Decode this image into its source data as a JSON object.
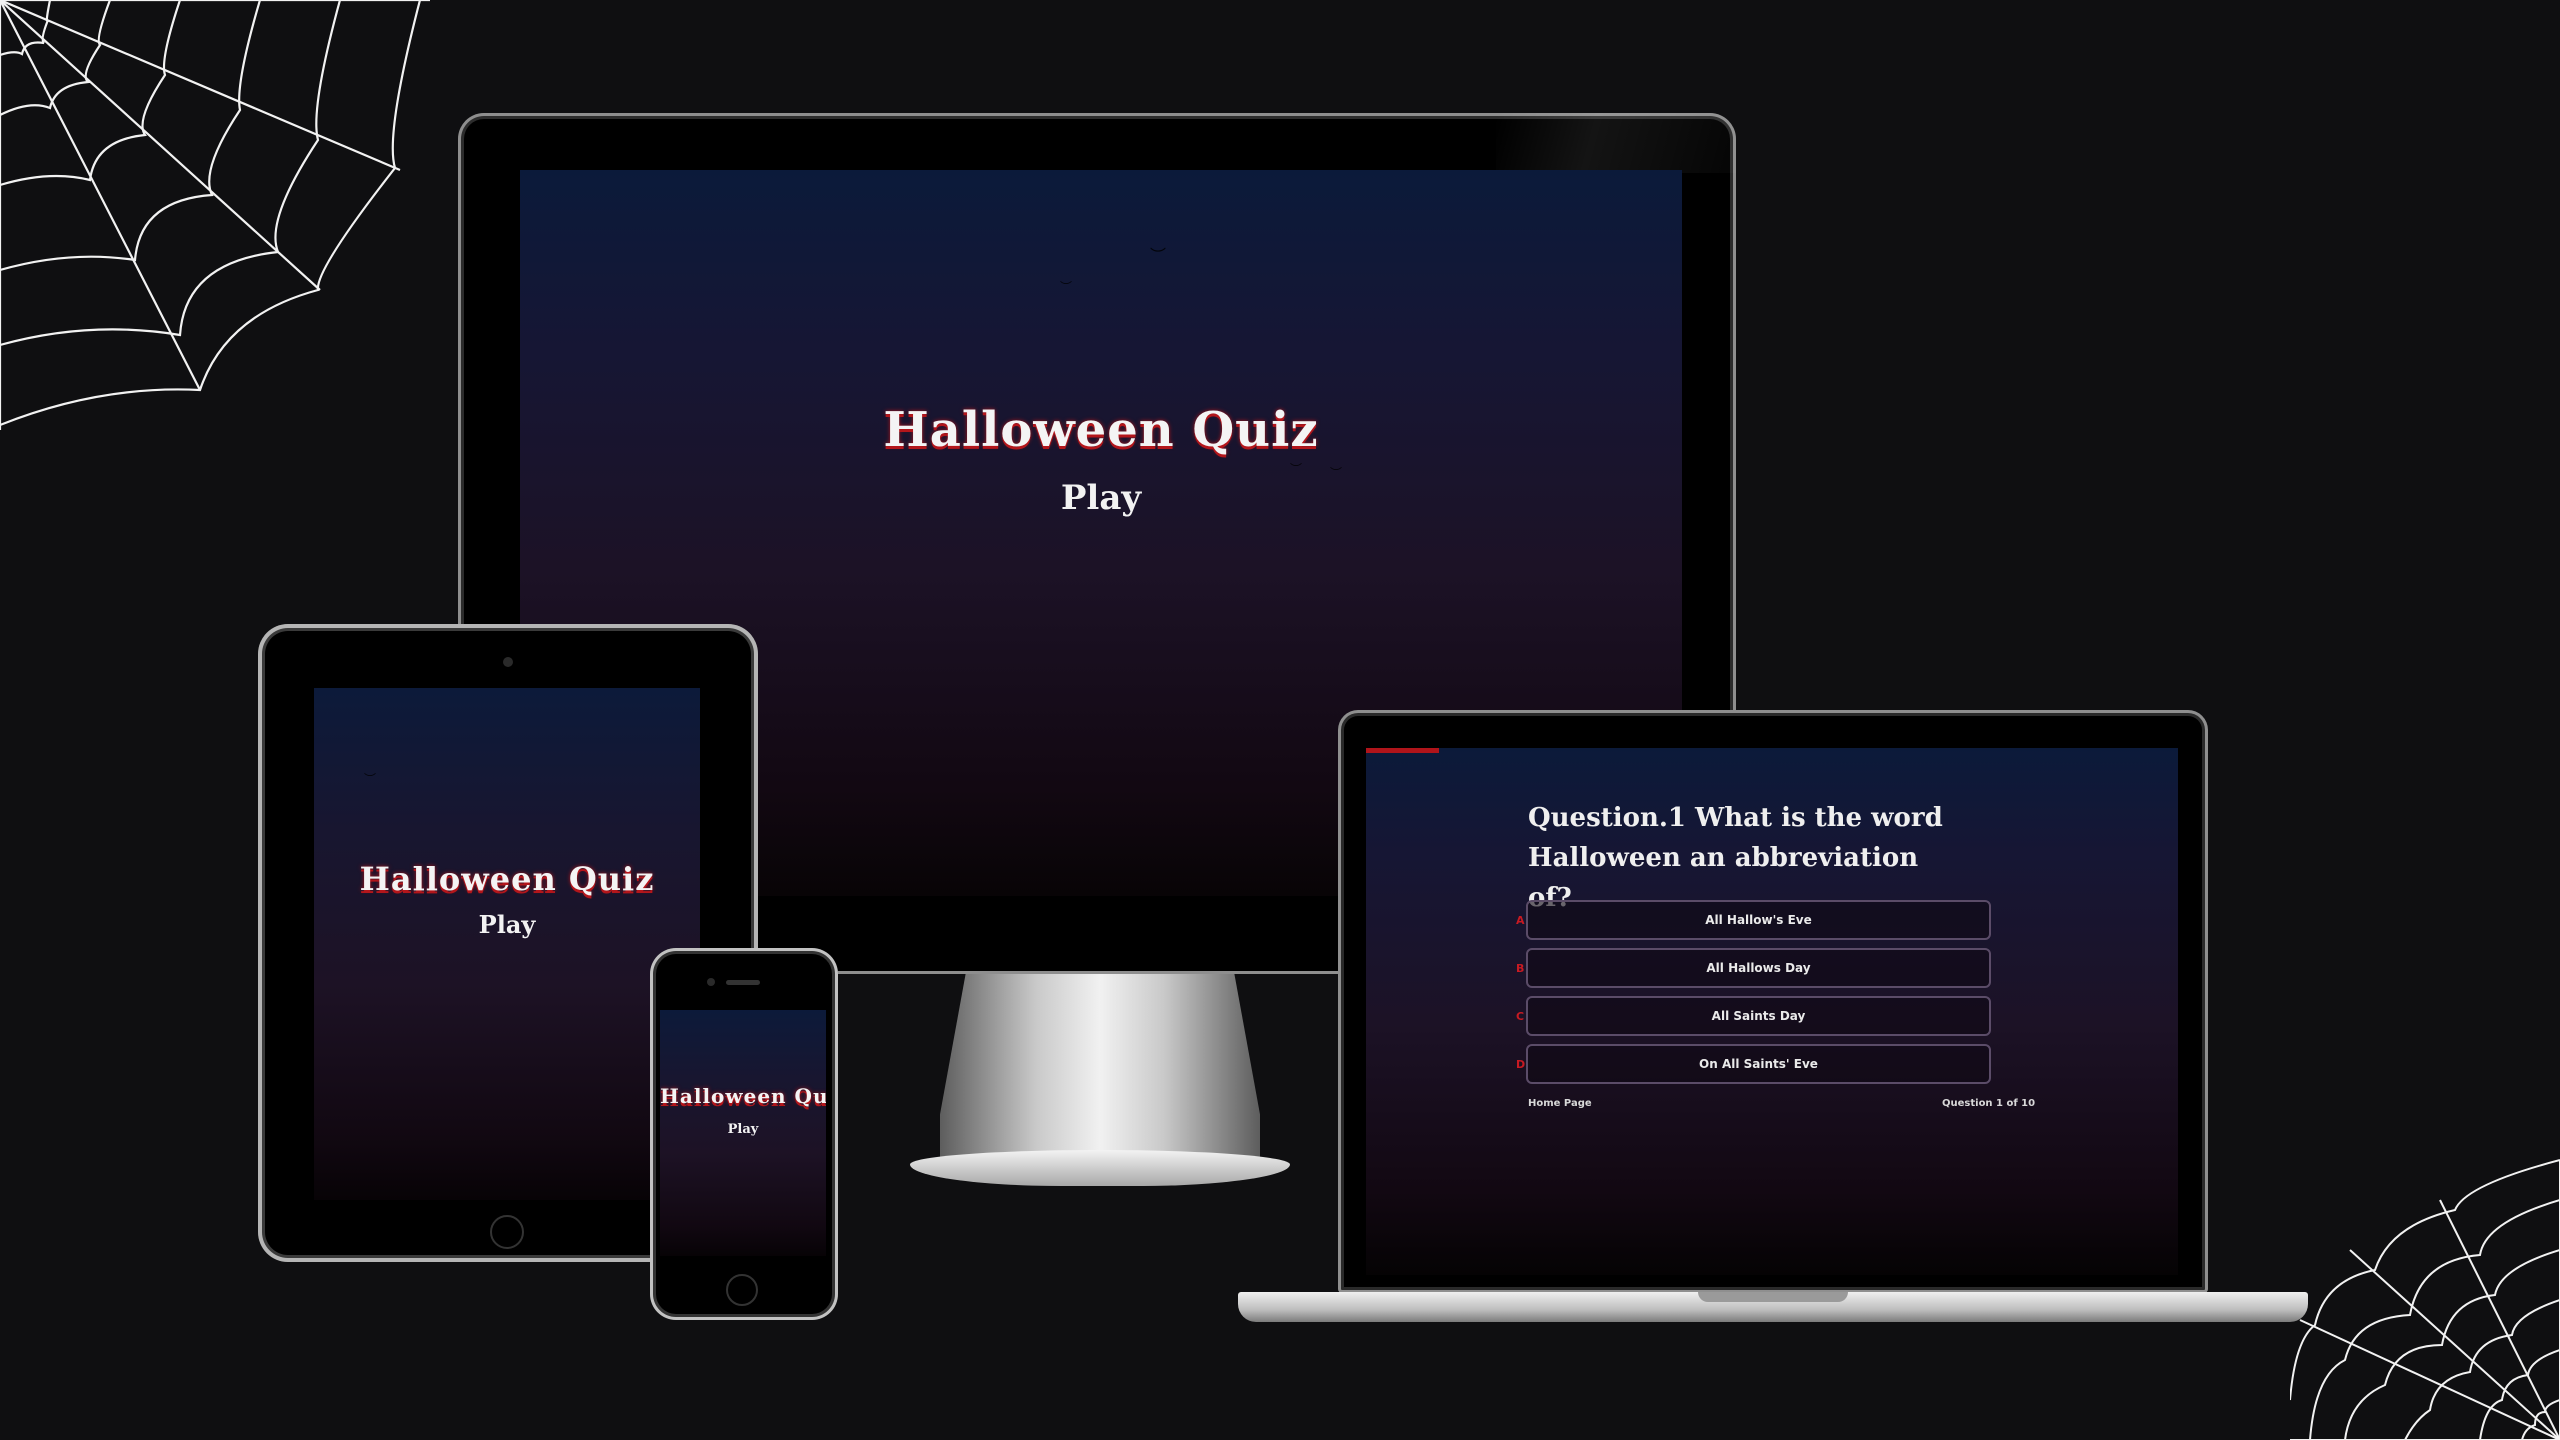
{
  "monitor": {
    "title": "Halloween Quiz",
    "play_label": "Play"
  },
  "tablet": {
    "title": "Halloween Quiz",
    "play_label": "Play"
  },
  "phone": {
    "title": "Halloween Quiz",
    "play_label": "Play"
  },
  "laptop": {
    "question": "Question.1 What is the word Halloween an abbreviation of?",
    "answers": [
      {
        "letter": "A",
        "text": "All Hallow's Eve"
      },
      {
        "letter": "B",
        "text": "All Hallows Day"
      },
      {
        "letter": "C",
        "text": "All Saints Day"
      },
      {
        "letter": "D",
        "text": "On All Saints' Eve"
      }
    ],
    "home_link": "Home Page",
    "counter": "Question 1 of 10",
    "progress_fraction": 0.09
  },
  "colors": {
    "accent_red": "#b3161b",
    "background": "#0f0f11"
  }
}
